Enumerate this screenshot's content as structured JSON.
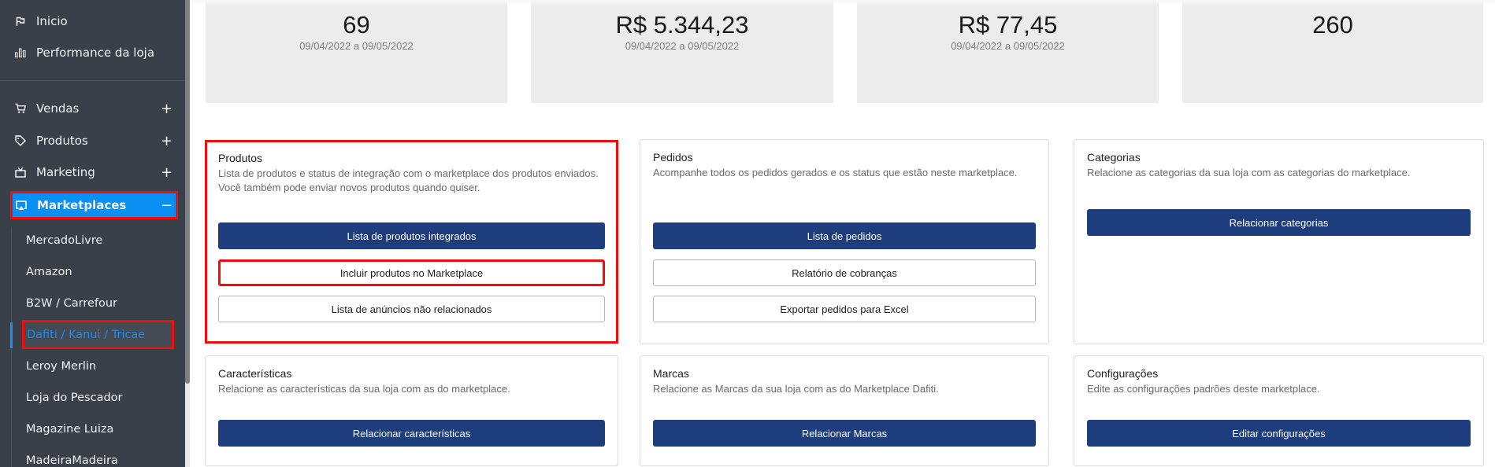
{
  "sidebar": {
    "top_items": [
      {
        "label": "Inicio",
        "icon": "flag-icon"
      },
      {
        "label": "Performance da loja",
        "icon": "bar-chart-icon"
      }
    ],
    "menu_items": [
      {
        "label": "Vendas",
        "icon": "cart-icon",
        "toggle": "+"
      },
      {
        "label": "Produtos",
        "icon": "tag-icon",
        "toggle": "+"
      },
      {
        "label": "Marketing",
        "icon": "tv-icon",
        "toggle": "+"
      },
      {
        "label": "Marketplaces",
        "icon": "airplay-icon",
        "toggle": "−"
      }
    ],
    "marketplaces": [
      "MercadoLivre",
      "Amazon",
      "B2W / Carrefour",
      "Dafiti / Kanui / Tricae",
      "Leroy Merlin",
      "Loja do Pescador",
      "Magazine Luiza",
      "MadeiraMadeira"
    ],
    "active_marketplace": "Dafiti / Kanui / Tricae"
  },
  "stats": [
    {
      "value": "69",
      "period": "09/04/2022 a 09/05/2022"
    },
    {
      "value": "R$ 5.344,23",
      "period": "09/04/2022 a 09/05/2022"
    },
    {
      "value": "R$ 77,45",
      "period": "09/04/2022 a 09/05/2022"
    },
    {
      "value": "260",
      "period": ""
    }
  ],
  "panels": {
    "produtos": {
      "title": "Produtos",
      "description": "Lista de produtos e status de integração com o marketplace dos produtos enviados. Você também pode enviar novos produtos quando quiser.",
      "buttons": [
        "Lista de produtos integrados",
        "Incluir produtos no Marketplace",
        "Lista de anúncios não relacionados"
      ]
    },
    "pedidos": {
      "title": "Pedidos",
      "description": "Acompanhe todos os pedidos gerados e os status que estão neste marketplace.",
      "buttons": [
        "Lista de pedidos",
        "Relatório de cobranças",
        "Exportar pedidos para Excel"
      ]
    },
    "categorias": {
      "title": "Categorias",
      "description": "Relacione as categorias da sua loja com as categorias do marketplace.",
      "buttons": [
        "Relacionar categorias"
      ]
    },
    "caracteristicas": {
      "title": "Características",
      "description": "Relacione as características da sua loja com as do marketplace.",
      "buttons": [
        "Relacionar características"
      ]
    },
    "marcas": {
      "title": "Marcas",
      "description": "Relacione as Marcas da sua loja com as do Marketplace Dafiti.",
      "buttons": [
        "Relacionar Marcas"
      ]
    },
    "configuracoes": {
      "title": "Configurações",
      "description": "Edite as configurações padrões deste marketplace.",
      "buttons": [
        "Editar configurações"
      ]
    }
  },
  "colors": {
    "sidebar_bg": "#3a4049",
    "active_menu": "#0a8ff2",
    "active_link": "#1e8cf0",
    "primary_button": "#1e3d7d",
    "highlight_outline": "#f20d0d",
    "stat_card_bg": "#ececec"
  }
}
